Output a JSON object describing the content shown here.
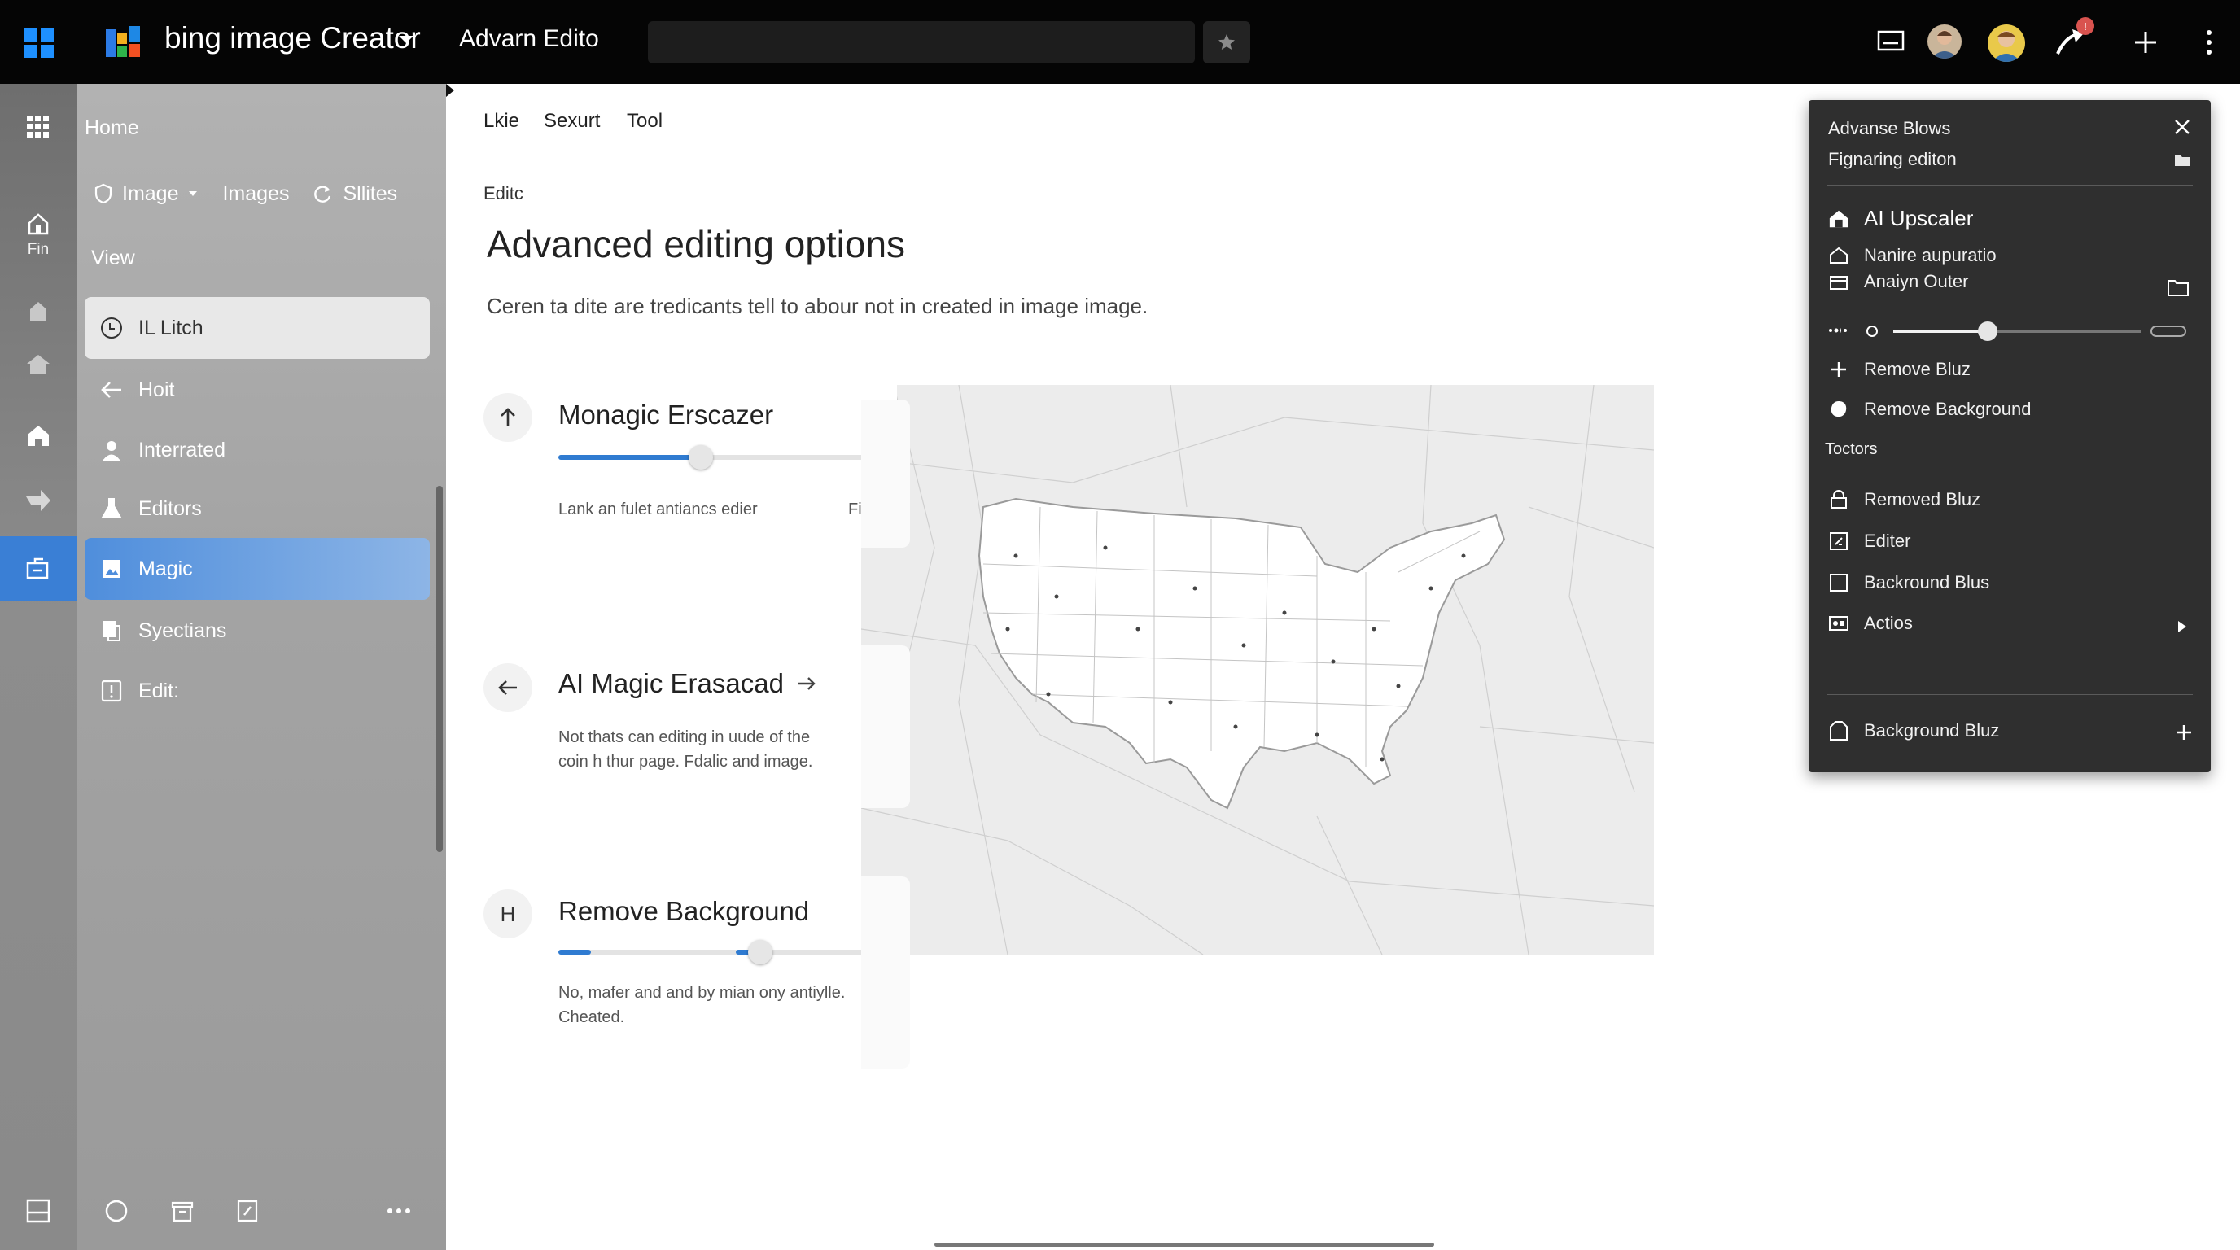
{
  "topbar": {
    "app_name": "bing image Creator",
    "document_title": "Advarn Edito",
    "search_placeholder": ""
  },
  "rail": {
    "home_caption": "Fin"
  },
  "sidebar": {
    "home": "Home",
    "tabs": [
      {
        "label": "Image"
      },
      {
        "label": "Images"
      },
      {
        "label": "Sllites"
      }
    ],
    "view_label": "View",
    "items": [
      {
        "label": "IL Litch",
        "icon": "time-icon"
      },
      {
        "label": "Hoit",
        "icon": "arrow-left-icon"
      },
      {
        "label": "Interrated",
        "icon": "person-icon"
      },
      {
        "label": "Editors",
        "icon": "flask-icon"
      },
      {
        "label": "Magic",
        "icon": "image-icon"
      },
      {
        "label": "Syectians",
        "icon": "document-icon"
      },
      {
        "label": "Edit:",
        "icon": "alert-icon"
      }
    ]
  },
  "main": {
    "menu": [
      "Lkie",
      "Sexurt",
      "Tool"
    ],
    "breadcrumb": "Editc",
    "title": "Advanced editing options",
    "description": "Ceren ta dite are tredicants tell to abour not in created in image image.",
    "cards": [
      {
        "icon": "arrow-up-icon",
        "title": "Monagic Erscazer",
        "caption_left": "Lank an fulet antiancs edier",
        "caption_right": "Fillo;",
        "slider_value": 0.45
      },
      {
        "icon": "arrow-left-icon",
        "title": "AI Magic Erasacad",
        "description_line1": "Not thats can editing in uude of the",
        "description_line2": "coin h thur page. Fdalic and image."
      },
      {
        "icon_letter": "H",
        "title": "Remove Background",
        "description_line1": "No, mafer and and by mian ony antiylle.",
        "description_line2": "Cheated.",
        "slider_value": 0.64
      }
    ]
  },
  "panel": {
    "title": "Advanse Blows",
    "subtitle": "Fignaring editon",
    "upscaler_label": "AI Upscaler",
    "items_top": [
      {
        "label": "Nanire aupuratio"
      },
      {
        "label": "Anaiyn Outer"
      }
    ],
    "slider_value": 0.38,
    "actions": [
      {
        "label": "Remove Bluz"
      },
      {
        "label": "Remove Background"
      }
    ],
    "section_label": "Toctors",
    "tools": [
      {
        "label": "Removed Bluz"
      },
      {
        "label": "Editer"
      },
      {
        "label": "Backround Blus"
      },
      {
        "label": "Actios"
      }
    ],
    "bottom_item": "Background Bluz"
  },
  "colors": {
    "accent": "#2f7bd1",
    "topbar": "#050505",
    "panel": "#2f2f2f",
    "notification": "#d9534f"
  }
}
